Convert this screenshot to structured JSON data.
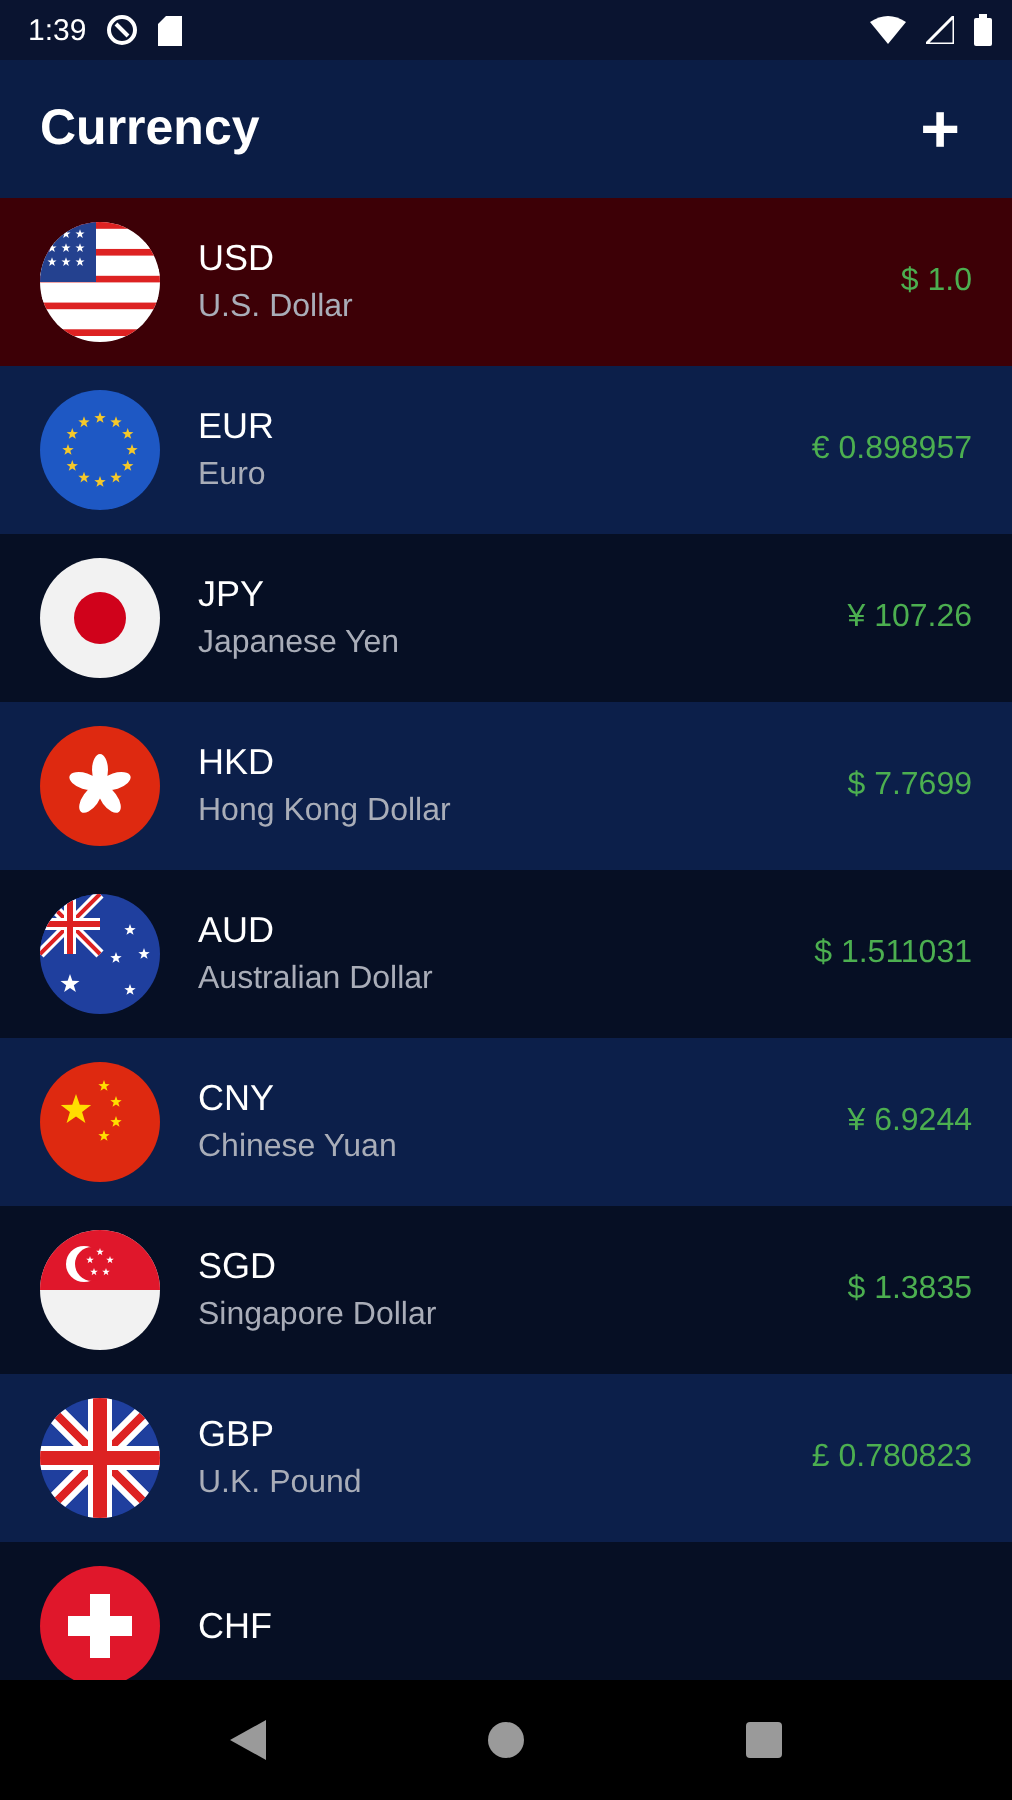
{
  "status_bar": {
    "time": "1:39"
  },
  "app_bar": {
    "title": "Currency",
    "add_label": "+"
  },
  "currencies": [
    {
      "code": "USD",
      "name": "U.S. Dollar",
      "rate": "$ 1.0",
      "kind": "us",
      "selected": true
    },
    {
      "code": "EUR",
      "name": "Euro",
      "rate": "€ 0.898957",
      "kind": "eu",
      "selected": false
    },
    {
      "code": "JPY",
      "name": "Japanese Yen",
      "rate": "¥ 107.26",
      "kind": "jp",
      "selected": false
    },
    {
      "code": "HKD",
      "name": "Hong Kong Dollar",
      "rate": "$ 7.7699",
      "kind": "hk",
      "selected": false
    },
    {
      "code": "AUD",
      "name": "Australian Dollar",
      "rate": "$ 1.511031",
      "kind": "au",
      "selected": false
    },
    {
      "code": "CNY",
      "name": "Chinese Yuan",
      "rate": "¥ 6.9244",
      "kind": "cn",
      "selected": false
    },
    {
      "code": "SGD",
      "name": "Singapore Dollar",
      "rate": "$ 1.3835",
      "kind": "sg",
      "selected": false
    },
    {
      "code": "GBP",
      "name": "U.K. Pound",
      "rate": "£ 0.780823",
      "kind": "gb",
      "selected": false
    },
    {
      "code": "CHF",
      "kind": "ch",
      "selected": false
    }
  ]
}
